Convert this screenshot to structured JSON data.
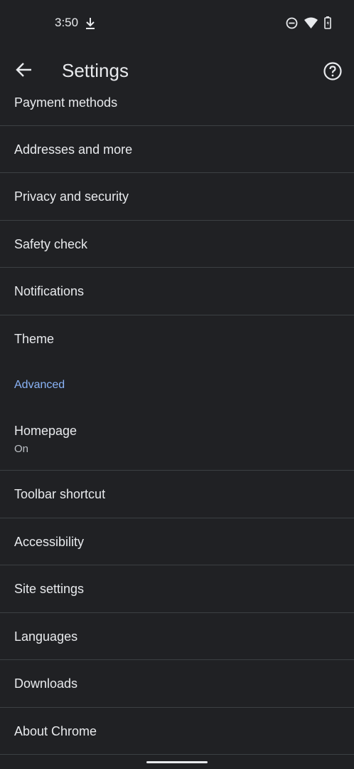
{
  "status_bar": {
    "time": "3:50"
  },
  "app_bar": {
    "title": "Settings"
  },
  "items": [
    {
      "label": "Payment methods"
    },
    {
      "label": "Addresses and more"
    },
    {
      "label": "Privacy and security"
    },
    {
      "label": "Safety check"
    },
    {
      "label": "Notifications"
    },
    {
      "label": "Theme"
    }
  ],
  "section": {
    "advanced": "Advanced"
  },
  "homepage": {
    "label": "Homepage",
    "sub": "On"
  },
  "advanced_items": [
    {
      "label": "Toolbar shortcut"
    },
    {
      "label": "Accessibility"
    },
    {
      "label": "Site settings"
    },
    {
      "label": "Languages"
    },
    {
      "label": "Downloads"
    },
    {
      "label": "About Chrome"
    }
  ],
  "colors": {
    "background": "#202124",
    "text": "#e8eaed",
    "accent": "#8ab4f8",
    "divider": "#3c4043"
  }
}
